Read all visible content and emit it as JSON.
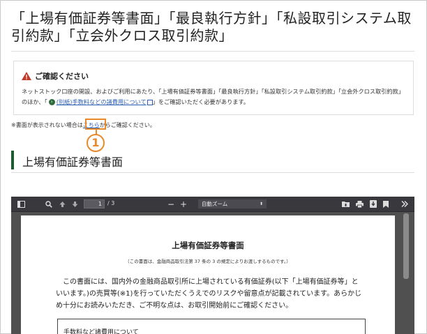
{
  "page": {
    "title": "「上場有価証券等書面」「最良執行方針」「私設取引システム取引約款」「立会外クロス取引約款」"
  },
  "notice": {
    "title": "ご確認ください",
    "body_prefix": "ネットストック口座の開設、およびご利用にあたり、「上場有価証券等書面」「最良執行方針」「私設取引システム取引約款」「立会外クロス取引約款」のほか、「",
    "link_label": "(別紙)手数料などの諸費用について",
    "body_suffix": "」をご確認いただく必要があります。"
  },
  "pdf_note": {
    "prefix": "※書面が表示されない場合は",
    "link_label": "こちら",
    "suffix": "からご確認ください。"
  },
  "marker": {
    "label": "1"
  },
  "section": {
    "title": "上場有価証券等書面"
  },
  "viewer": {
    "page_input": "1",
    "page_count": "/ 3",
    "zoom_label": "自動ズーム",
    "zoom_minus": "−",
    "zoom_plus": "+",
    "icons": [
      "sidebar-toggle-icon",
      "search-icon",
      "previous-page-icon",
      "next-page-icon",
      "zoom-out-icon",
      "zoom-in-icon",
      "open-file-icon",
      "print-icon",
      "download-icon",
      "bookmark-icon",
      "more-tools-icon"
    ]
  },
  "document": {
    "title": "上場有価証券等書面",
    "subtitle": "（この書面は、金融商品取引法第 37 条の 3 の規定によりお渡しするものです。）",
    "paragraph": "　この書面には、国内外の金融商品取引所に上場されている有価証券(以下「上場有価証券等」といいます。)の売買等(※1)を行っていただくうえでのリスクや留意点が記載されています。あらかじめ十分にお読みいただき、ご不明な点は、お取引開始前にご確認ください。",
    "box_text": "手数料など諸費用について"
  },
  "colors": {
    "accent_green": "#1d5b34",
    "highlight_orange": "#e8892b",
    "link_blue": "#2a5db0",
    "warning_red": "#c0392b",
    "viewer_bg": "#505050",
    "toolbar_bg": "#38383d"
  }
}
